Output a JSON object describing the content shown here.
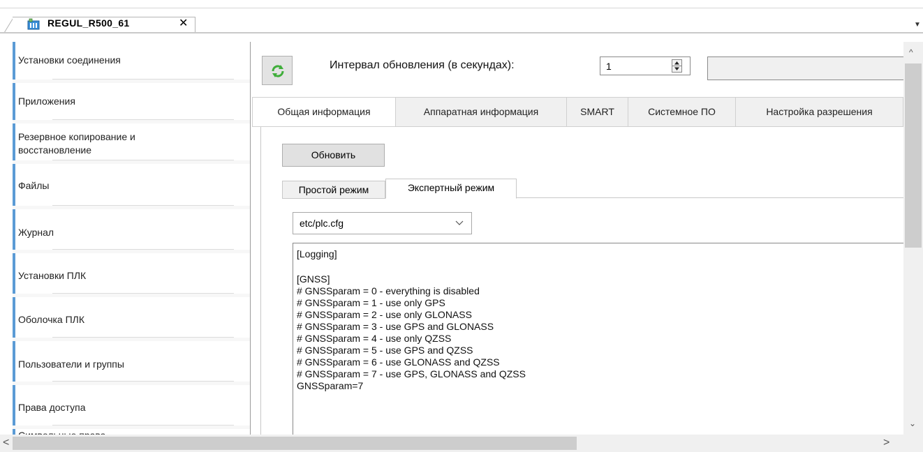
{
  "doc_tab": {
    "title": "REGUL_R500_61",
    "close_glyph": "✕",
    "icon": "plc-device-icon",
    "dropdown_glyph": "▼"
  },
  "sidebar": {
    "items": [
      {
        "label": "Установки соединения"
      },
      {
        "label": "Приложения"
      },
      {
        "label": "Резервное копирование и\nвосстановление"
      },
      {
        "label": "Файлы"
      },
      {
        "label": "Журнал"
      },
      {
        "label": "Установки ПЛК"
      },
      {
        "label": "Оболочка ПЛК"
      },
      {
        "label": "Пользователи и группы"
      },
      {
        "label": "Права доступа"
      },
      {
        "label": "Символьные права"
      }
    ],
    "accent_color": "#5b9bd5"
  },
  "toolbar": {
    "refresh_icon": "refresh-icon",
    "interval_label": "Интервал обновления (в секундах):",
    "interval_value": "1"
  },
  "main_tabs": [
    {
      "label": "Общая информация"
    },
    {
      "label": "Аппаратная информация"
    },
    {
      "label": "SMART"
    },
    {
      "label": "Системное ПО"
    },
    {
      "label": "Настройка разрешения"
    }
  ],
  "content": {
    "update_button": "Обновить",
    "sub_tabs": [
      {
        "label": "Простой режим"
      },
      {
        "label": "Экспертный режим"
      }
    ],
    "file_select": {
      "value": "etc/plc.cfg"
    },
    "config_lines": [
      "[Logging]",
      "",
      "[GNSS]",
      "# GNSSparam = 0 - everything is disabled",
      "# GNSSparam = 1 - use only GPS",
      "# GNSSparam = 2 - use only GLONASS",
      "# GNSSparam = 3 - use GPS and GLONASS",
      "# GNSSparam = 4 - use only QZSS",
      "# GNSSparam = 5 - use GPS and QZSS",
      "# GNSSparam = 6 - use GLONASS and QZSS",
      "# GNSSparam = 7 - use GPS, GLONASS and QZSS",
      "GNSSparam=7"
    ]
  },
  "scrollbars": {
    "up": "^",
    "down": "⌄",
    "left": "<",
    "right": ">"
  }
}
